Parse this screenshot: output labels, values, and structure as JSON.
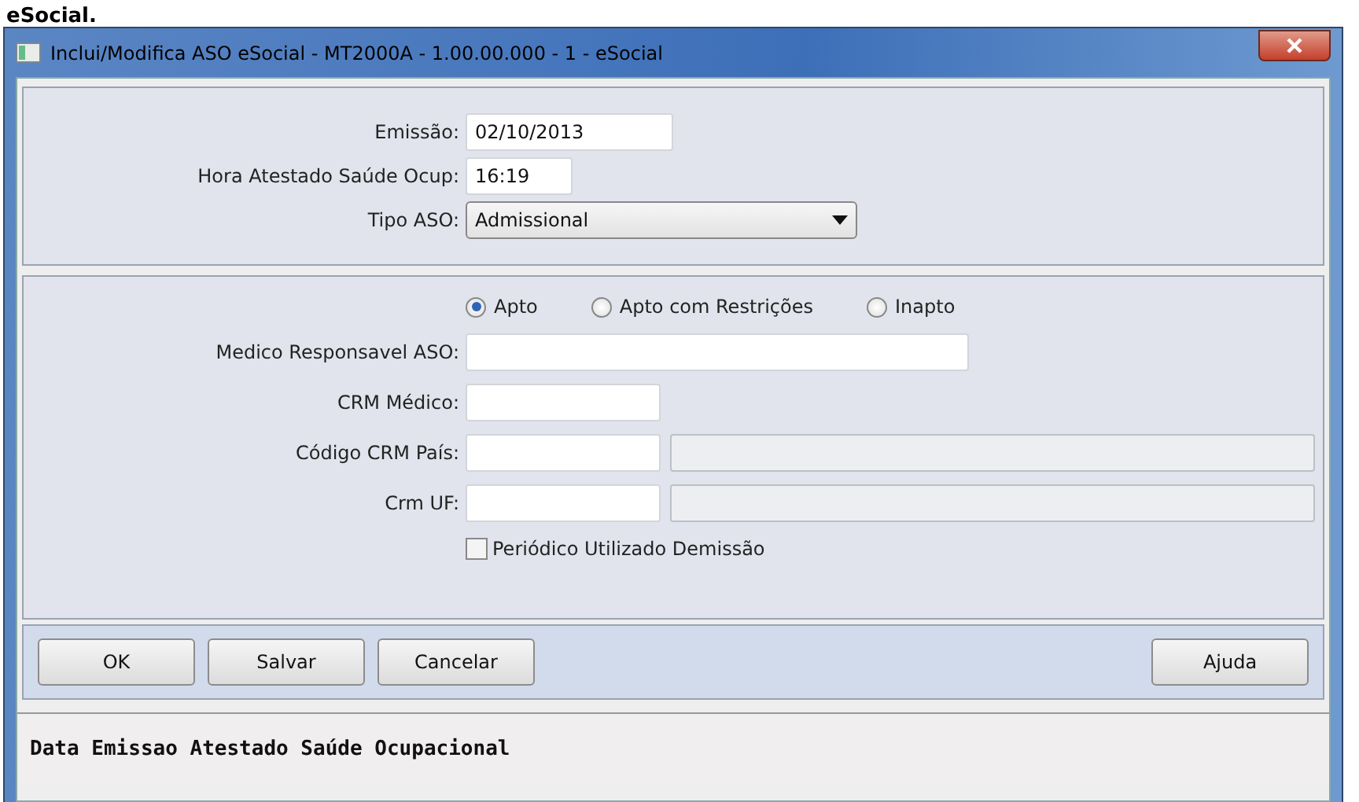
{
  "page_caption": "eSocial.",
  "window": {
    "title": "Inclui/Modifica ASO eSocial - MT2000A - 1.00.00.000 - 1 - eSocial"
  },
  "header_fields": [
    {
      "label": "Emissão:",
      "kind": "date",
      "value": "02/10/2013"
    },
    {
      "label": "Hora Atestado Saúde Ocup:",
      "kind": "time",
      "value": "16:19"
    },
    {
      "label": "Tipo ASO:",
      "kind": "dropdown",
      "value": "Admissional"
    }
  ],
  "result_options": [
    {
      "label": "Apto",
      "selected": true
    },
    {
      "label": "Apto com Restrições",
      "selected": false
    },
    {
      "label": "Inapto",
      "selected": false
    }
  ],
  "detail_fields": [
    {
      "label": "Medico Responsavel ASO:",
      "kind": "wide"
    },
    {
      "label": "CRM Médico:",
      "kind": "short"
    },
    {
      "label": "Código CRM País:",
      "kind": "lookup"
    },
    {
      "label": "Crm UF:",
      "kind": "lookup"
    }
  ],
  "checkbox": {
    "label": "Periódico Utilizado Demissão",
    "checked": false
  },
  "buttons_left": [
    "OK",
    "Salvar",
    "Cancelar"
  ],
  "buttons_right": [
    "Ajuda"
  ],
  "status_bar": {
    "text": "Data Emissao Atestado Saúde Ocupacional"
  }
}
